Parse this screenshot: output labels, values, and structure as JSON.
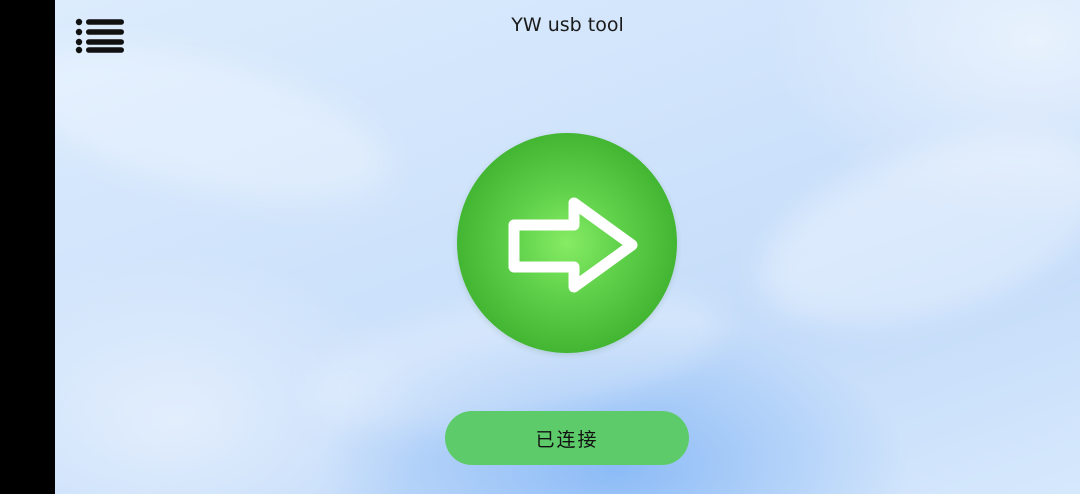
{
  "header": {
    "title": "YW usb tool",
    "menu_icon": "list-menu-icon"
  },
  "main": {
    "connect_icon": "arrow-right-icon",
    "status_label": "已连接"
  },
  "colors": {
    "background": "#cfe3fb",
    "circle_green": "#3fb22f",
    "status_button_green": "#5ecb6a",
    "side_bar": "#000000"
  }
}
